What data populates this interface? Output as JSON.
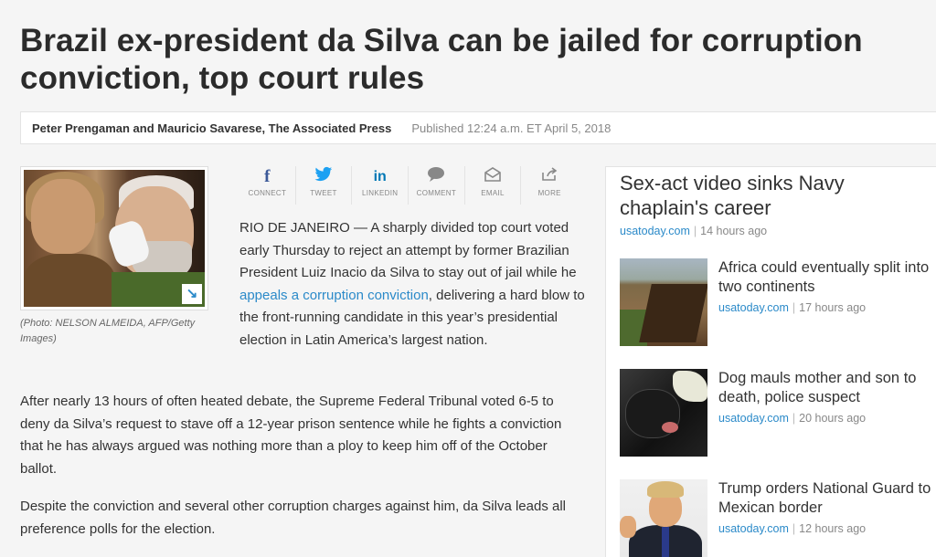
{
  "article": {
    "headline": "Brazil ex-president da Silva can be jailed for corruption conviction, top court rules",
    "authors": "Peter Prengaman and Mauricio Savarese, The Associated Press",
    "published": "Published 12:24 a.m. ET April 5, 2018",
    "photo_caption": "(Photo: NELSON ALMEIDA, AFP/Getty Images)",
    "lede_before": "RIO DE JANEIRO — A sharply divided top court voted early Thursday to reject an attempt by former Brazilian President Luiz Inacio da Silva to stay out of jail while he ",
    "lede_link": "appeals a corruption conviction",
    "lede_after": ", delivering a hard blow to the front-running candidate in this year’s presidential election in Latin America’s largest nation.",
    "paragraph_2": "After nearly 13 hours of often heated debate, the Supreme Federal Tribunal voted 6-5 to deny da Silva’s request to stave off a 12-year prison sentence while he fights a conviction that he has always argued was nothing more than a ploy to keep him off of the October ballot.",
    "paragraph_3": "Despite the conviction and several other corruption charges against him, da Silva leads all preference polls for the election."
  },
  "share": [
    {
      "label": "CONNECT",
      "icon": "facebook-icon",
      "glyph": "f"
    },
    {
      "label": "TWEET",
      "icon": "twitter-icon",
      "glyph": "🐦"
    },
    {
      "label": "LINKEDIN",
      "icon": "linkedin-icon",
      "glyph": "in"
    },
    {
      "label": "COMMENT",
      "icon": "comment-icon",
      "glyph": "💬"
    },
    {
      "label": "EMAIL",
      "icon": "email-icon",
      "glyph": "✉"
    },
    {
      "label": "MORE",
      "icon": "share-icon",
      "glyph": "⇪"
    }
  ],
  "sidebar": {
    "top_story": {
      "title": "Sex-act video sinks Navy chaplain's career",
      "source": "usatoday.com",
      "time": "14 hours ago"
    },
    "items": [
      {
        "title": "Africa could eventually split into two continents",
        "source": "usatoday.com",
        "time": "17 hours ago"
      },
      {
        "title": "Dog mauls mother and son to death, police suspect",
        "source": "usatoday.com",
        "time": "20 hours ago"
      },
      {
        "title": "Trump orders National Guard to Mexican border",
        "source": "usatoday.com",
        "time": "12 hours ago"
      }
    ]
  },
  "colors": {
    "link": "#2b8ac9",
    "facebook": "#3b5998",
    "twitter": "#1da1f2",
    "linkedin": "#0077b5"
  }
}
